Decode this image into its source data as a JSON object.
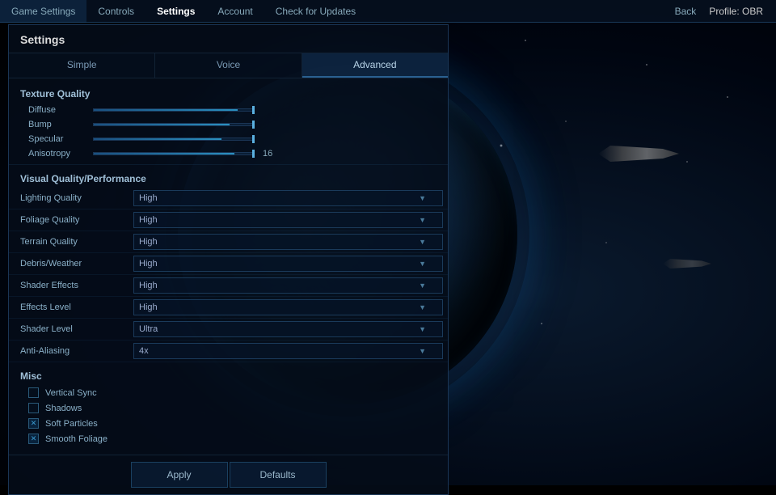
{
  "topbar": {
    "nav_items": [
      {
        "id": "game-settings",
        "label": "Game Settings",
        "active": false
      },
      {
        "id": "controls",
        "label": "Controls",
        "active": false
      },
      {
        "id": "settings",
        "label": "Settings",
        "active": true
      },
      {
        "id": "account",
        "label": "Account",
        "active": false
      },
      {
        "id": "check-updates",
        "label": "Check for Updates",
        "active": false
      }
    ],
    "back_label": "Back",
    "profile_label": "Profile: OBR"
  },
  "panel": {
    "title": "Settings",
    "tabs": [
      {
        "id": "simple",
        "label": "Simple",
        "active": false
      },
      {
        "id": "voice",
        "label": "Voice",
        "active": false
      },
      {
        "id": "advanced",
        "label": "Advanced",
        "active": true
      }
    ],
    "texture_quality": {
      "header": "Texture Quality",
      "sliders": [
        {
          "id": "diffuse",
          "label": "Diffuse",
          "value": 90,
          "display": ""
        },
        {
          "id": "bump",
          "label": "Bump",
          "value": 85,
          "display": ""
        },
        {
          "id": "specular",
          "label": "Specular",
          "value": 80,
          "display": ""
        },
        {
          "id": "anisotropy",
          "label": "Anisotropy",
          "value": 88,
          "display": "16"
        }
      ]
    },
    "visual_quality": {
      "header": "Visual Quality/Performance",
      "dropdowns": [
        {
          "id": "lighting-quality",
          "label": "Lighting Quality",
          "value": "High"
        },
        {
          "id": "foliage-quality",
          "label": "Foliage Quality",
          "value": "High"
        },
        {
          "id": "terrain-quality",
          "label": "Terrain Quality",
          "value": "High"
        },
        {
          "id": "debris-weather",
          "label": "Debris/Weather",
          "value": "High"
        },
        {
          "id": "shader-effects",
          "label": "Shader Effects",
          "value": "High"
        },
        {
          "id": "effects-level",
          "label": "Effects Level",
          "value": "High"
        },
        {
          "id": "shader-level",
          "label": "Shader Level",
          "value": "Ultra"
        },
        {
          "id": "anti-aliasing",
          "label": "Anti-Aliasing",
          "value": "4x"
        }
      ]
    },
    "misc": {
      "header": "Misc",
      "checkboxes": [
        {
          "id": "vertical-sync",
          "label": "Vertical Sync",
          "checked": false,
          "x_checked": false
        },
        {
          "id": "shadows",
          "label": "Shadows",
          "checked": false,
          "x_checked": false
        },
        {
          "id": "soft-particles",
          "label": "Soft Particles",
          "checked": false,
          "x_checked": true
        },
        {
          "id": "smooth-foliage",
          "label": "Smooth Foliage",
          "checked": false,
          "x_checked": true
        }
      ]
    },
    "footer": {
      "apply_label": "Apply",
      "defaults_label": "Defaults"
    }
  }
}
